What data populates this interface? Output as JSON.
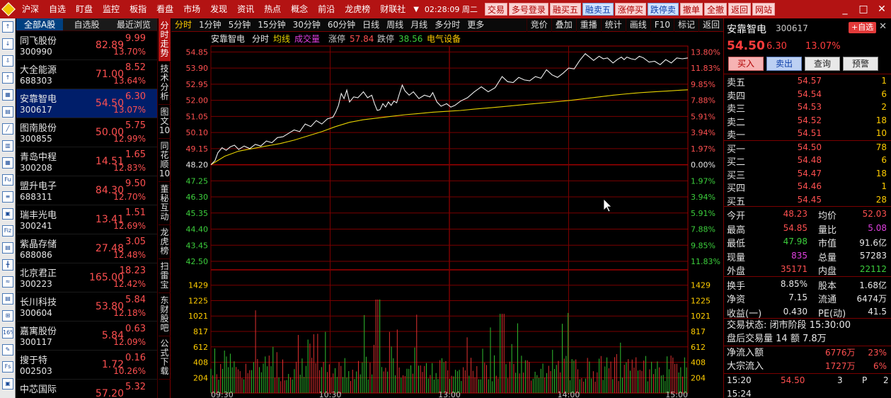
{
  "menu": {
    "items": [
      "沪深",
      "自选",
      "盯盘",
      "监控",
      "板指",
      "看盘",
      "市场",
      "发现",
      "资讯",
      "热点",
      "概念",
      "前沿",
      "龙虎榜",
      "财联社"
    ],
    "time": "02:28:09",
    "weekday": "周二",
    "buttons": [
      {
        "label": "交易",
        "style": "red"
      },
      {
        "label": "多号登录",
        "style": "red"
      },
      {
        "label": "融买五",
        "style": "red"
      },
      {
        "label": "融卖五",
        "style": "blue"
      },
      {
        "label": "涨停买",
        "style": "red"
      },
      {
        "label": "跌停卖",
        "style": "blue"
      },
      {
        "label": "撤单",
        "style": "red"
      },
      {
        "label": "全撤",
        "style": "red"
      },
      {
        "label": "返回",
        "style": "red"
      },
      {
        "label": "网站",
        "style": "red"
      }
    ],
    "window_controls": [
      "_",
      "□",
      "✕"
    ]
  },
  "left_toolbar": [
    "↑",
    "↓",
    "⇩",
    "↑",
    "▦",
    "▤",
    "╱",
    "▥",
    "▦",
    "Fu",
    "≡",
    "▣",
    "Fiz",
    "▤",
    "╋",
    "≈",
    "▤",
    "⊞",
    "16%",
    "✎",
    "Fs",
    "▣"
  ],
  "watchlist": {
    "tabs": [
      "全部A股",
      "自选股",
      "最近浏览"
    ],
    "items": [
      {
        "name": "同飞股份",
        "code": "300990",
        "price": "82.89",
        "change": "9.99",
        "pct": "13.70%"
      },
      {
        "name": "大全能源",
        "code": "688303",
        "price": "71.00",
        "change": "8.52",
        "pct": "13.64%"
      },
      {
        "name": "安靠智电",
        "code": "300617",
        "price": "54.50",
        "change": "6.30",
        "pct": "13.07%"
      },
      {
        "name": "图南股份",
        "code": "300855",
        "price": "50.00",
        "change": "5.75",
        "pct": "12.99%"
      },
      {
        "name": "青岛中程",
        "code": "300208",
        "price": "14.51",
        "change": "1.65",
        "pct": "12.83%"
      },
      {
        "name": "盟升电子",
        "code": "688311",
        "price": "84.30",
        "change": "9.50",
        "pct": "12.70%"
      },
      {
        "name": "瑞丰光电",
        "code": "300241",
        "price": "13.41",
        "change": "1.51",
        "pct": "12.69%"
      },
      {
        "name": "紫晶存储",
        "code": "688086",
        "price": "27.48",
        "change": "3.05",
        "pct": "12.48%"
      },
      {
        "name": "北京君正",
        "code": "300223",
        "price": "165.00",
        "change": "18.23",
        "pct": "12.42%"
      },
      {
        "name": "长川科技",
        "code": "300604",
        "price": "53.80",
        "change": "5.84",
        "pct": "12.18%"
      },
      {
        "name": "嘉寓股份",
        "code": "300117",
        "price": "5.84",
        "change": "0.63",
        "pct": "12.09%"
      },
      {
        "name": "搜于特",
        "code": "002503",
        "price": "1.72",
        "change": "0.16",
        "pct": "10.26%"
      },
      {
        "name": "中芯国际",
        "code": "",
        "price": "57.20",
        "change": "5.32",
        "pct": ""
      }
    ]
  },
  "vertical_tabs": [
    "分时走势",
    "技术分析",
    "图文10",
    "同花顺10",
    "董秘互动",
    "龙虎榜",
    "扫雷宝",
    "东财股吧",
    "公式下载"
  ],
  "chart_toolbar": {
    "periods": [
      "分时",
      "1分钟",
      "5分钟",
      "15分钟",
      "30分钟",
      "60分钟",
      "日线",
      "周线",
      "月线",
      "多分时",
      "更多"
    ],
    "tools": [
      "竞价",
      "叠加",
      "重播",
      "统计",
      "画线",
      "F10",
      "标记",
      "返回"
    ]
  },
  "chart_header": {
    "name": "安靠智电",
    "mode": "分时",
    "avg_label": "均线",
    "vol_label": "成交量",
    "limit_up_label": "涨停",
    "limit_up": "57.84",
    "limit_down_label": "跌停",
    "limit_down": "38.56",
    "sector": "电气设备"
  },
  "chart_data": {
    "type": "line",
    "x_ticks": [
      "09:30",
      "10:30",
      "13:00",
      "14:00",
      "15:00"
    ],
    "price_ticks": [
      "54.85",
      "53.90",
      "52.95",
      "52.00",
      "51.05",
      "50.10",
      "49.15",
      "48.20",
      "47.25",
      "46.30",
      "45.35",
      "44.40",
      "43.45",
      "42.50"
    ],
    "pct_ticks": [
      "13.80%",
      "11.83%",
      "9.85%",
      "7.88%",
      "5.91%",
      "3.94%",
      "1.97%",
      "0.00%",
      "1.97%",
      "3.94%",
      "5.91%",
      "7.88%",
      "9.85%",
      "11.83%"
    ],
    "pct_colors": [
      "red",
      "red",
      "red",
      "red",
      "red",
      "red",
      "red",
      "white",
      "green",
      "green",
      "green",
      "green",
      "green",
      "green"
    ],
    "vol_ticks": [
      "1429",
      "1225",
      "1021",
      "817",
      "612",
      "408",
      "204"
    ],
    "prev_close": 48.2,
    "ylim": [
      42.0,
      55.2
    ],
    "vol_max": 1633,
    "price_line": [
      [
        0,
        48.2
      ],
      [
        3,
        48.45
      ],
      [
        5,
        48.9
      ],
      [
        8,
        49.2
      ],
      [
        11,
        49.05
      ],
      [
        14,
        49.25
      ],
      [
        17,
        49.35
      ],
      [
        20,
        49.1
      ],
      [
        24,
        49.3
      ],
      [
        28,
        49.15
      ],
      [
        32,
        49.4
      ],
      [
        36,
        49.3
      ],
      [
        40,
        49.6
      ],
      [
        44,
        49.5
      ],
      [
        48,
        49.8
      ],
      [
        52,
        49.85
      ],
      [
        56,
        50.05
      ],
      [
        60,
        50.25
      ],
      [
        64,
        50.15
      ],
      [
        68,
        50.6
      ],
      [
        72,
        50.45
      ],
      [
        76,
        50.8
      ],
      [
        80,
        50.6
      ],
      [
        84,
        50.9
      ],
      [
        88,
        51.0
      ],
      [
        90,
        51.3
      ],
      [
        92,
        51.7
      ],
      [
        94,
        52.4
      ],
      [
        96,
        52.1
      ],
      [
        98,
        52.6
      ],
      [
        100,
        51.9
      ],
      [
        103,
        52.2
      ],
      [
        106,
        52.15
      ],
      [
        110,
        52.5
      ],
      [
        113,
        52.15
      ],
      [
        116,
        52.3
      ],
      [
        118,
        51.8
      ],
      [
        120,
        51.4
      ],
      [
        122,
        51.45
      ],
      [
        124,
        51.8
      ],
      [
        126,
        51.6
      ],
      [
        128,
        51.9
      ],
      [
        130,
        51.7
      ],
      [
        132,
        51.95
      ],
      [
        134,
        51.85
      ],
      [
        136,
        52.4
      ],
      [
        138,
        52.9
      ],
      [
        140,
        52.55
      ],
      [
        143,
        52.3
      ],
      [
        146,
        52.5
      ],
      [
        150,
        52.1
      ],
      [
        154,
        52.3
      ],
      [
        158,
        52.2
      ],
      [
        160,
        52.45
      ],
      [
        163,
        51.9
      ],
      [
        166,
        51.65
      ],
      [
        170,
        51.8
      ],
      [
        173,
        51.6
      ],
      [
        176,
        51.7
      ],
      [
        180,
        51.95
      ],
      [
        185,
        52.15
      ],
      [
        190,
        52.5
      ],
      [
        195,
        52.8
      ],
      [
        200,
        52.5
      ],
      [
        205,
        52.75
      ],
      [
        210,
        53.4
      ],
      [
        214,
        53.1
      ],
      [
        218,
        53.05
      ],
      [
        222,
        53.35
      ],
      [
        226,
        53.2
      ],
      [
        230,
        53.15
      ],
      [
        234,
        53.4
      ],
      [
        238,
        53.3
      ],
      [
        242,
        53.8
      ],
      [
        246,
        53.5
      ],
      [
        250,
        53.35
      ],
      [
        254,
        53.6
      ],
      [
        258,
        53.9
      ],
      [
        262,
        53.85
      ],
      [
        266,
        54.35
      ],
      [
        270,
        54.75
      ],
      [
        273,
        54.55
      ],
      [
        276,
        54.35
      ],
      [
        280,
        54.6
      ],
      [
        283,
        54.45
      ],
      [
        286,
        54.5
      ],
      [
        290,
        54.2
      ],
      [
        293,
        54.4
      ],
      [
        296,
        54.55
      ],
      [
        298,
        54.4
      ],
      [
        300,
        54.55
      ],
      [
        303,
        54.45
      ],
      [
        306,
        54.4
      ],
      [
        309,
        54.6
      ],
      [
        312,
        54.5
      ],
      [
        316,
        54.25
      ],
      [
        320,
        54.3
      ],
      [
        324,
        54.1
      ],
      [
        328,
        54.4
      ],
      [
        332,
        54.2
      ],
      [
        336,
        54.5
      ],
      [
        340,
        54.45
      ],
      [
        344,
        54.5
      ]
    ],
    "avg_line": [
      [
        0,
        48.2
      ],
      [
        10,
        48.7
      ],
      [
        20,
        49.0
      ],
      [
        30,
        49.15
      ],
      [
        40,
        49.3
      ],
      [
        50,
        49.45
      ],
      [
        60,
        49.65
      ],
      [
        70,
        49.9
      ],
      [
        80,
        50.15
      ],
      [
        90,
        50.45
      ],
      [
        100,
        50.7
      ],
      [
        110,
        50.85
      ],
      [
        120,
        50.95
      ],
      [
        130,
        51.05
      ],
      [
        140,
        51.15
      ],
      [
        150,
        51.22
      ],
      [
        160,
        51.3
      ],
      [
        170,
        51.35
      ],
      [
        180,
        51.4
      ],
      [
        190,
        51.48
      ],
      [
        200,
        51.55
      ],
      [
        210,
        51.62
      ],
      [
        220,
        51.7
      ],
      [
        230,
        51.78
      ],
      [
        240,
        51.85
      ],
      [
        250,
        51.92
      ],
      [
        260,
        52.0
      ],
      [
        270,
        52.1
      ],
      [
        280,
        52.2
      ],
      [
        290,
        52.3
      ],
      [
        300,
        52.38
      ],
      [
        310,
        52.45
      ],
      [
        320,
        52.5
      ],
      [
        330,
        52.55
      ],
      [
        340,
        52.6
      ],
      [
        344,
        52.62
      ]
    ]
  },
  "quote": {
    "name": "安靠智电",
    "code": "300617",
    "add_label": "+自选",
    "close_label": "✕",
    "price": "54.50",
    "change": "6.30",
    "pct": "13.07%",
    "buttons": [
      "买入",
      "卖出",
      "查询",
      "预警"
    ],
    "asks": [
      {
        "label": "卖五",
        "price": "54.57",
        "vol": "1"
      },
      {
        "label": "卖四",
        "price": "54.54",
        "vol": "6"
      },
      {
        "label": "卖三",
        "price": "54.53",
        "vol": "2"
      },
      {
        "label": "卖二",
        "price": "54.52",
        "vol": "18"
      },
      {
        "label": "卖一",
        "price": "54.51",
        "vol": "10"
      }
    ],
    "bids": [
      {
        "label": "买一",
        "price": "54.50",
        "vol": "78"
      },
      {
        "label": "买二",
        "price": "54.48",
        "vol": "6"
      },
      {
        "label": "买三",
        "price": "54.47",
        "vol": "18"
      },
      {
        "label": "买四",
        "price": "54.46",
        "vol": "1"
      },
      {
        "label": "买五",
        "price": "54.45",
        "vol": "28"
      }
    ],
    "stats": [
      {
        "l1": "今开",
        "v1": "48.23",
        "c1": "red",
        "l2": "均价",
        "v2": "52.03",
        "c2": "red"
      },
      {
        "l1": "最高",
        "v1": "54.85",
        "c1": "red",
        "l2": "量比",
        "v2": "5.08",
        "c2": "mag"
      },
      {
        "l1": "最低",
        "v1": "47.98",
        "c1": "green",
        "l2": "市值",
        "v2": "91.6亿",
        "c2": "white"
      },
      {
        "l1": "现量",
        "v1": "835",
        "c1": "mag",
        "l2": "总量",
        "v2": "57283",
        "c2": "white"
      },
      {
        "l1": "外盘",
        "v1": "35171",
        "c1": "red",
        "l2": "内盘",
        "v2": "22112",
        "c2": "green"
      }
    ],
    "stats2": [
      {
        "l1": "换手",
        "v1": "8.85%",
        "l2": "股本",
        "v2": "1.68亿"
      },
      {
        "l1": "净资",
        "v1": "7.15",
        "l2": "流通",
        "v2": "6474万"
      },
      {
        "l1": "收益(一)",
        "v1": "0.430",
        "l2": "PE(动)",
        "v2": "41.5"
      }
    ],
    "status_label": "交易状态:",
    "status": "闭市阶段",
    "status_time": "15:30:00",
    "after_label": "盘后交易量",
    "after_vol": "14",
    "after_amt_label": "额",
    "after_amt": "7.8万",
    "inflow_label": "净流入额",
    "inflow": "6776万",
    "inflow_pct": "23%",
    "block_label": "大宗流入",
    "block": "1727万",
    "block_pct": "6%",
    "ticks": [
      {
        "time": "15:20",
        "price": "54.50",
        "vol": "3",
        "flag": "P",
        "n": "2"
      },
      {
        "time": "15:24",
        "price": "",
        "vol": "",
        "flag": "",
        "n": ""
      }
    ]
  }
}
